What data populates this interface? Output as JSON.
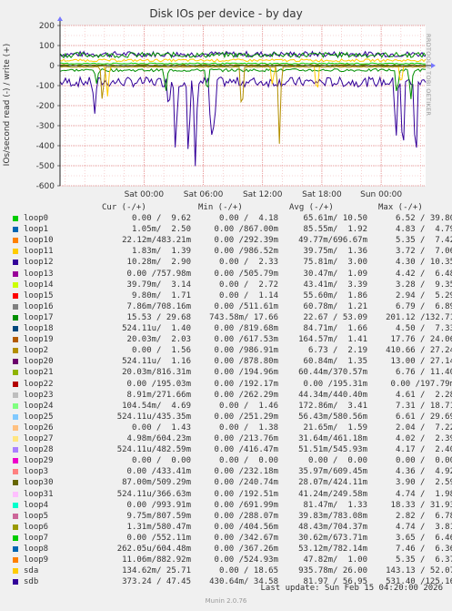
{
  "title": "Disk IOs per device - by day",
  "watermark": "RRDTOOL / TOBI OETIKER",
  "footer": {
    "last_update": "Last update: Sun Feb 15 04:20:00 2026",
    "munin": "Munin 2.0.76"
  },
  "legend": {
    "columns": [
      "Cur (-/+)",
      "Min (-/+)",
      "Avg (-/+)",
      "Max (-/+)"
    ],
    "rows": [
      {
        "name": "loop0",
        "color": "#00cc00",
        "cur": "0.00 /  9.62",
        "min": "0.00 /  4.18",
        "avg": "65.61m/ 10.50",
        "max": "6.52 / 39.80"
      },
      {
        "name": "loop1",
        "color": "#0066b3",
        "cur": "1.05m/  2.50",
        "min": "0.00 /867.00m",
        "avg": "85.55m/  1.92",
        "max": "4.83 /  4.79"
      },
      {
        "name": "loop10",
        "color": "#ff8000",
        "cur": "22.12m/483.21m",
        "min": "0.00 /292.39m",
        "avg": "49.77m/696.67m",
        "max": "5.35 /  7.42"
      },
      {
        "name": "loop11",
        "color": "#ffcc00",
        "cur": "1.83m/  1.39",
        "min": "0.00 /986.52m",
        "avg": "39.75m/  1.36",
        "max": "3.72 /  7.06"
      },
      {
        "name": "loop12",
        "color": "#330099",
        "cur": "10.28m/  2.90",
        "min": "0.00 /  2.33",
        "avg": "75.81m/  3.00",
        "max": "4.30 / 10.35"
      },
      {
        "name": "loop13",
        "color": "#990099",
        "cur": "0.00 /757.98m",
        "min": "0.00 /505.79m",
        "avg": "30.47m/  1.09",
        "max": "4.42 /  6.48"
      },
      {
        "name": "loop14",
        "color": "#ccff00",
        "cur": "39.79m/  3.14",
        "min": "0.00 /  2.72",
        "avg": "43.41m/  3.39",
        "max": "3.28 /  9.35"
      },
      {
        "name": "loop15",
        "color": "#ff0000",
        "cur": "9.80m/  1.71",
        "min": "0.00 /  1.14",
        "avg": "55.60m/  1.86",
        "max": "2.94 /  5.29"
      },
      {
        "name": "loop16",
        "color": "#808080",
        "cur": "7.86m/708.16m",
        "min": "0.00 /511.61m",
        "avg": "60.78m/  1.21",
        "max": "6.79 /  6.89"
      },
      {
        "name": "loop17",
        "color": "#008f00",
        "cur": "15.53 / 29.68",
        "min": "743.58m/ 17.66",
        "avg": "22.67 / 53.09",
        "max": "201.12 /132.71"
      },
      {
        "name": "loop18",
        "color": "#00487d",
        "cur": "524.11u/  1.40",
        "min": "0.00 /819.68m",
        "avg": "84.71m/  1.66",
        "max": "4.50 /  7.33"
      },
      {
        "name": "loop19",
        "color": "#b35a00",
        "cur": "20.03m/  2.03",
        "min": "0.00 /617.53m",
        "avg": "164.57m/  1.41",
        "max": "17.76 / 24.06"
      },
      {
        "name": "loop2",
        "color": "#b38f00",
        "cur": "0.00 /  1.56",
        "min": "0.00 /986.91m",
        "avg": "6.73 /  2.19",
        "max": "410.66 / 27.24"
      },
      {
        "name": "loop20",
        "color": "#6b006b",
        "cur": "524.11u/  1.16",
        "min": "0.00 /878.80m",
        "avg": "60.84m/  1.35",
        "max": "13.00 / 27.14"
      },
      {
        "name": "loop21",
        "color": "#8fb300",
        "cur": "20.03m/816.31m",
        "min": "0.00 /194.96m",
        "avg": "60.44m/370.57m",
        "max": "6.76 / 11.40"
      },
      {
        "name": "loop22",
        "color": "#b30000",
        "cur": "0.00 /195.03m",
        "min": "0.00 /192.17m",
        "avg": "0.00 /195.31m",
        "max": "0.00 /197.79m"
      },
      {
        "name": "loop23",
        "color": "#bebebe",
        "cur": "8.91m/271.66m",
        "min": "0.00 /262.29m",
        "avg": "44.34m/440.40m",
        "max": "4.61 /  2.28"
      },
      {
        "name": "loop24",
        "color": "#80ff80",
        "cur": "104.54m/  4.69",
        "min": "0.00 /  1.46",
        "avg": "172.86m/  3.41",
        "max": "7.31 / 18.71"
      },
      {
        "name": "loop25",
        "color": "#80c9ff",
        "cur": "524.11u/435.35m",
        "min": "0.00 /251.29m",
        "avg": "56.43m/580.56m",
        "max": "6.61 / 29.69"
      },
      {
        "name": "loop26",
        "color": "#ffc080",
        "cur": "0.00 /  1.43",
        "min": "0.00 /  1.38",
        "avg": "21.65m/  1.59",
        "max": "2.04 /  7.22"
      },
      {
        "name": "loop27",
        "color": "#ffe680",
        "cur": "4.98m/604.23m",
        "min": "0.00 /213.76m",
        "avg": "31.64m/461.18m",
        "max": "4.02 /  2.39"
      },
      {
        "name": "loop28",
        "color": "#aa80ff",
        "cur": "524.11u/482.59m",
        "min": "0.00 /416.47m",
        "avg": "51.51m/545.93m",
        "max": "4.17 /  2.40"
      },
      {
        "name": "loop29",
        "color": "#ee00cc",
        "cur": "0.00 /  0.00",
        "min": "0.00 /  0.00",
        "avg": "0.00 /  0.00",
        "max": "0.00 /  0.00"
      },
      {
        "name": "loop3",
        "color": "#ff8080",
        "cur": "0.00 /433.41m",
        "min": "0.00 /232.18m",
        "avg": "35.97m/609.45m",
        "max": "4.36 /  4.92"
      },
      {
        "name": "loop30",
        "color": "#666600",
        "cur": "87.00m/509.29m",
        "min": "0.00 /240.74m",
        "avg": "28.07m/424.11m",
        "max": "3.90 /  2.59"
      },
      {
        "name": "loop31",
        "color": "#ffbfff",
        "cur": "524.11u/366.63m",
        "min": "0.00 /192.51m",
        "avg": "41.24m/249.58m",
        "max": "4.74 /  1.98"
      },
      {
        "name": "loop4",
        "color": "#00ffcc",
        "cur": "0.00 /993.91m",
        "min": "0.00 /691.99m",
        "avg": "81.47m/  1.33",
        "max": "18.33 / 31.93"
      },
      {
        "name": "loop5",
        "color": "#cc6699",
        "cur": "9.75m/807.59m",
        "min": "0.00 /288.07m",
        "avg": "39.83m/783.08m",
        "max": "2.82 /  6.78"
      },
      {
        "name": "loop6",
        "color": "#999900",
        "cur": "1.31m/580.47m",
        "min": "0.00 /404.56m",
        "avg": "48.43m/704.37m",
        "max": "4.74 /  3.81"
      },
      {
        "name": "loop7",
        "color": "#00cc00",
        "cur": "0.00 /552.11m",
        "min": "0.00 /342.67m",
        "avg": "30.62m/673.71m",
        "max": "3.65 /  6.46"
      },
      {
        "name": "loop8",
        "color": "#0066b3",
        "cur": "262.05u/604.48m",
        "min": "0.00 /367.26m",
        "avg": "53.12m/782.14m",
        "max": "7.46 /  6.36"
      },
      {
        "name": "loop9",
        "color": "#ff8000",
        "cur": "11.06m/882.92m",
        "min": "0.00 /524.93m",
        "avg": "47.82m/  1.00",
        "max": "5.35 /  6.37"
      },
      {
        "name": "sda",
        "color": "#ffcc00",
        "cur": "134.62m/ 25.71",
        "min": "0.00 / 18.65",
        "avg": "935.78m/ 26.00",
        "max": "143.13 / 52.07"
      },
      {
        "name": "sdb",
        "color": "#330099",
        "cur": "373.24 / 47.45",
        "min": "430.64m/ 34.58",
        "avg": "81.97 / 56.95",
        "max": "531.40 /125.16"
      }
    ]
  },
  "chart_data": {
    "type": "line",
    "title": "Disk IOs per device - by day",
    "ylabel": "IOs/second read (-) / write (+)",
    "xlabel": "",
    "ylim": [
      -600,
      200
    ],
    "yticks": [
      200,
      100,
      0,
      -100,
      -200,
      -300,
      -400,
      -500,
      -600
    ],
    "xticks": [
      "Sat 00:00",
      "Sat 06:00",
      "Sat 12:00",
      "Sat 18:00",
      "Sun 00:00"
    ],
    "x_range_hours": [
      -8.5,
      28.5
    ],
    "xtick_hours": [
      0,
      6,
      12,
      18,
      24
    ],
    "grid": true,
    "series": [
      {
        "name": "sdb",
        "color": "#330099",
        "write_level": 57,
        "read_level": -82,
        "read_spikes": [
          [
            -5.0,
            -250
          ],
          [
            2.5,
            -230
          ],
          [
            3.2,
            -480
          ],
          [
            4.5,
            -500
          ],
          [
            5.2,
            -520
          ],
          [
            6.8,
            -420
          ],
          [
            7.1,
            -380
          ],
          [
            25.5,
            -400
          ],
          [
            26.2,
            -510
          ],
          [
            27.5,
            -550
          ]
        ]
      },
      {
        "name": "loop17",
        "color": "#008f00",
        "write_level": 53,
        "read_level": -23,
        "read_spikes": [
          [
            -4.8,
            -90
          ],
          [
            2.2,
            -140
          ],
          [
            6.4,
            -150
          ],
          [
            25.6,
            -160
          ],
          [
            27.0,
            -180
          ]
        ]
      },
      {
        "name": "sda",
        "color": "#ffcc00",
        "write_level": 26,
        "read_level": -1,
        "read_spikes": [
          [
            -3.7,
            -160
          ],
          [
            13.0,
            -110
          ],
          [
            17.5,
            -160
          ],
          [
            26.0,
            -110
          ]
        ]
      },
      {
        "name": "loop0",
        "color": "#00cc00",
        "write_level": 10,
        "read_level": 0,
        "read_spikes": []
      },
      {
        "name": "loop2",
        "color": "#b38f00",
        "write_level": 2,
        "read_level": -7,
        "read_spikes": [
          [
            -4.2,
            -200
          ],
          [
            9.9,
            -270
          ],
          [
            13.7,
            -390
          ]
        ]
      }
    ]
  }
}
